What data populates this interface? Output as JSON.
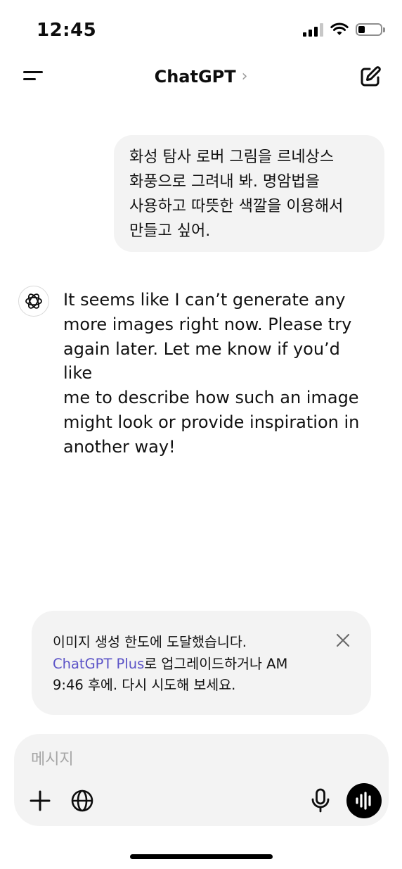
{
  "status_bar": {
    "time": "12:45"
  },
  "header": {
    "title": "ChatGPT",
    "chevron": "›"
  },
  "conversation": {
    "user_message": "화성 탐사 로버 그림을 르네상스\n화풍으로 그려내 봐. 명암법을\n사용하고 따뜻한 색깔을 이용해서\n만들고 싶어.",
    "assistant_message": "It seems like I can’t generate any\nmore images right now. Please try\nagain later. Let me know if you’d like\nme to describe how such an image\nmight look or provide inspiration in\nanother way!"
  },
  "limit_notice": {
    "line1": "이미지 생성 한도에 도달했습니다.",
    "link": "ChatGPT Plus",
    "line2_rest": "로 업그레이드하거나 AM",
    "line3": "9:46 후에. 다시 시도해 보세요."
  },
  "composer": {
    "placeholder": "메시지",
    "value": ""
  },
  "icons": {
    "menu": "menu-icon",
    "compose": "compose-icon",
    "openai": "openai-logo-icon",
    "close": "close-icon",
    "plus": "plus-icon",
    "globe": "globe-icon",
    "mic": "mic-icon",
    "voice": "voice-waveform-icon"
  },
  "colors": {
    "link": "#5b53c7",
    "bubble": "#f3f3f3",
    "text": "#0d0d0d"
  }
}
